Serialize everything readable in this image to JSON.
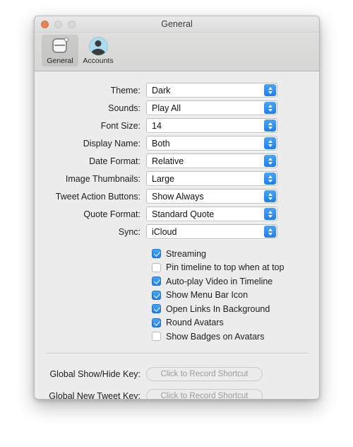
{
  "window": {
    "title": "General",
    "traffic_lights": [
      {
        "name": "close",
        "color": "#e8834a"
      },
      {
        "name": "minimize",
        "color": "#d8d8d8"
      },
      {
        "name": "zoom",
        "color": "#d8d8d8"
      }
    ]
  },
  "toolbar": {
    "items": [
      {
        "label": "General",
        "icon": "preferences-general-icon",
        "selected": true
      },
      {
        "label": "Accounts",
        "icon": "user-avatar-icon",
        "selected": false
      }
    ]
  },
  "settings": {
    "rows": [
      {
        "label": "Theme:",
        "value": "Dark",
        "name": "theme"
      },
      {
        "label": "Sounds:",
        "value": "Play All",
        "name": "sounds"
      },
      {
        "label": "Font Size:",
        "value": "14",
        "name": "font-size"
      },
      {
        "label": "Display Name:",
        "value": "Both",
        "name": "display-name"
      },
      {
        "label": "Date Format:",
        "value": "Relative",
        "name": "date-format"
      },
      {
        "label": "Image Thumbnails:",
        "value": "Large",
        "name": "image-thumbnails"
      },
      {
        "label": "Tweet Action Buttons:",
        "value": "Show Always",
        "name": "tweet-action-buttons"
      },
      {
        "label": "Quote Format:",
        "value": "Standard Quote",
        "name": "quote-format"
      },
      {
        "label": "Sync:",
        "value": "iCloud",
        "name": "sync"
      }
    ]
  },
  "checkboxes": [
    {
      "label": "Streaming",
      "checked": true,
      "name": "streaming"
    },
    {
      "label": "Pin timeline to top when at top",
      "checked": false,
      "name": "pin-timeline"
    },
    {
      "label": "Auto-play Video in Timeline",
      "checked": true,
      "name": "autoplay-video"
    },
    {
      "label": "Show Menu Bar Icon",
      "checked": true,
      "name": "show-menu-bar-icon"
    },
    {
      "label": "Open Links In Background",
      "checked": true,
      "name": "open-links-background"
    },
    {
      "label": "Round Avatars",
      "checked": true,
      "name": "round-avatars"
    },
    {
      "label": "Show Badges on Avatars",
      "checked": false,
      "name": "show-badges-avatars"
    }
  ],
  "shortcuts": [
    {
      "label": "Global Show/Hide Key:",
      "placeholder": "Click to Record Shortcut",
      "name": "global-show-hide"
    },
    {
      "label": "Global New Tweet Key:",
      "placeholder": "Click to Record Shortcut",
      "name": "global-new-tweet"
    }
  ],
  "colors": {
    "accent": "#1f7ff0",
    "window_bg": "#ececec",
    "toolbar_bg": "#d6d6d4"
  }
}
